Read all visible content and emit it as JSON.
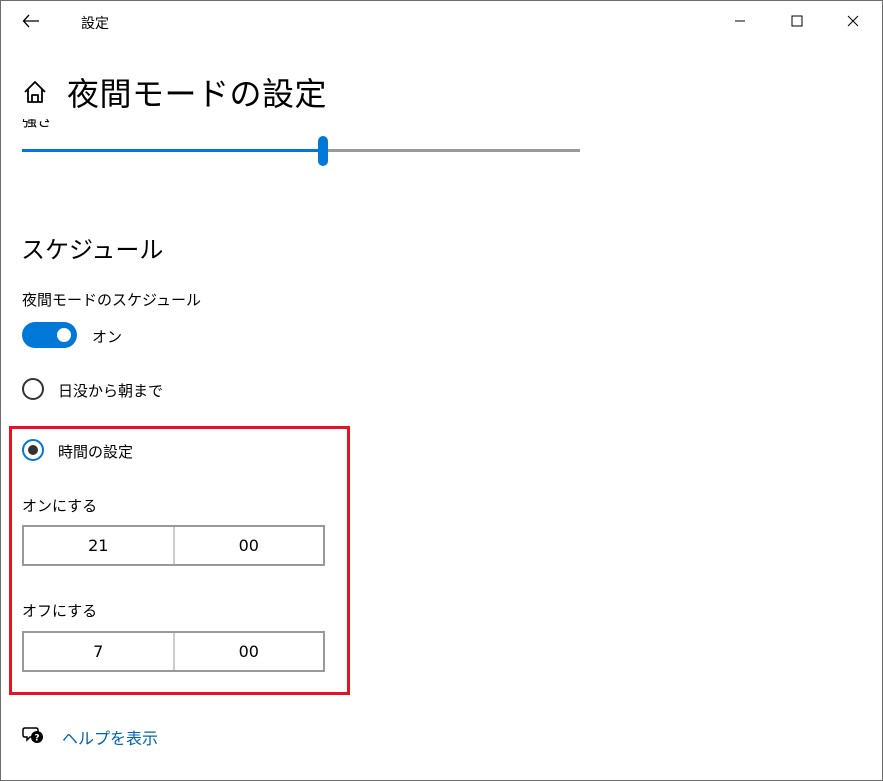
{
  "window": {
    "app_title": "設定",
    "controls": {
      "back": "back-arrow-icon",
      "minimize": "minimize-icon",
      "maximize": "maximize-icon",
      "close": "close-icon"
    }
  },
  "header": {
    "home_icon": "home-icon",
    "title": "夜間モードの設定"
  },
  "strength": {
    "label": "強さ",
    "value_percent": 54
  },
  "schedule": {
    "section_title": "スケジュール",
    "toggle_label": "夜間モードのスケジュール",
    "toggle_on": true,
    "toggle_state_text": "オン",
    "options": [
      {
        "label": "日没から朝まで",
        "selected": false
      },
      {
        "label": "時間の設定",
        "selected": true
      }
    ],
    "turn_on": {
      "label": "オンにする",
      "hour": "21",
      "minute": "00"
    },
    "turn_off": {
      "label": "オフにする",
      "hour": "7",
      "minute": "00"
    }
  },
  "help": {
    "icon": "help-chat-icon",
    "link_text": "ヘルプを表示"
  },
  "colors": {
    "accent": "#0078d7",
    "highlight": "#e81123",
    "link": "#0063b1"
  }
}
